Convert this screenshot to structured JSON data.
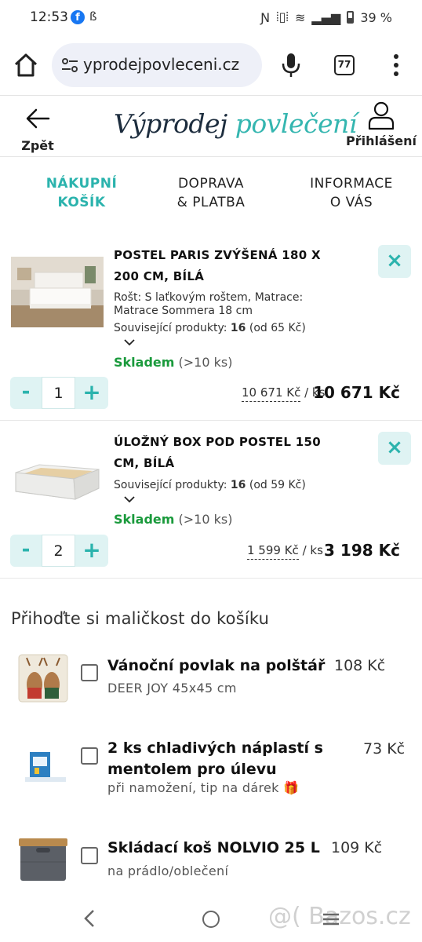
{
  "status_bar": {
    "time": "12:53",
    "battery": "39 %"
  },
  "browser": {
    "url": "vyprodejpovleceni.cz",
    "url_visible": "yprodejpovleceni.cz",
    "tab_count": "77"
  },
  "header": {
    "back_label": "Zpět",
    "logo_part1": "Výprodej",
    "logo_part2": "povlečení",
    "login_label": "Přihlášení"
  },
  "steps": [
    {
      "line1": "NÁKUPNÍ",
      "line2": "KOŠÍK",
      "active": true
    },
    {
      "line1": "DOPRAVA",
      "line2": "& PLATBA",
      "active": false
    },
    {
      "line1": "INFORMACE",
      "line2": "O VÁS",
      "active": false
    }
  ],
  "cart_items": [
    {
      "title_line1": "POSTEL PARIS ZVÝŠENÁ 180 X",
      "title_line2": "200 CM, BÍLÁ",
      "desc_line1": "Rošt: S laťkovým roštem, Matrace:",
      "desc_line2": "Matrace Sommera 18 cm",
      "related_prefix": "Související produkty: ",
      "related_count": "16",
      "related_suffix": " (od 65 Kč)",
      "stock": "Skladem",
      "stock_extra": "(>10 ks)",
      "quantity": "1",
      "unit_price": "10 671 Kč",
      "per_unit": " / ks",
      "total_price": "10 671 Kč"
    },
    {
      "title_line1": "ÚLOŽNÝ BOX POD POSTEL 150",
      "title_line2": "CM, BÍLÁ",
      "related_prefix": "Související produkty: ",
      "related_count": "16",
      "related_suffix": " (od 59 Kč)",
      "stock": "Skladem",
      "stock_extra": "(>10 ks)",
      "quantity": "2",
      "unit_price": "1 599 Kč",
      "per_unit": " / ks",
      "total_price": "3 198 Kč"
    }
  ],
  "addons": {
    "title": "Přihoďte si maličkost do košíku",
    "items": [
      {
        "name_line1": "Vánoční povlak na polštář",
        "name_line2": "",
        "sub": "DEER JOY 45x45 cm",
        "price": "108 Kč"
      },
      {
        "name_line1": "2 ks chladivých náplastí s",
        "name_line2": "mentolem pro úlevu",
        "sub": "při namožení, tip na dárek 🎁",
        "price": "73 Kč"
      },
      {
        "name_line1": "Skládací koš NOLVIO 25 L",
        "name_line2": "",
        "sub": "na prádlo/oblečení",
        "price": "109 Kč"
      }
    ]
  },
  "watermark": "@( Bazos.cz",
  "colors": {
    "accent": "#2bb3ad",
    "stock_green": "#1a9a3c",
    "logo_dark": "#1d2d3e"
  }
}
